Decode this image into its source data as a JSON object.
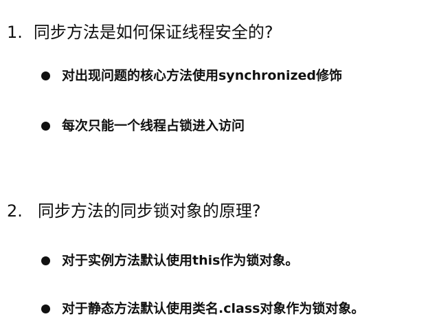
{
  "questions": [
    {
      "number": "1.",
      "text": "同步方法是如何保证线程安全的?",
      "bullets": [
        "对出现问题的核心方法使用synchronized修饰",
        "每次只能一个线程占锁进入访问"
      ]
    },
    {
      "number": "2.",
      "text": "同步方法的同步锁对象的原理?",
      "bullets": [
        "对于实例方法默认使用this作为锁对象。",
        "对于静态方法默认使用类名.class对象作为锁对象。"
      ]
    }
  ]
}
